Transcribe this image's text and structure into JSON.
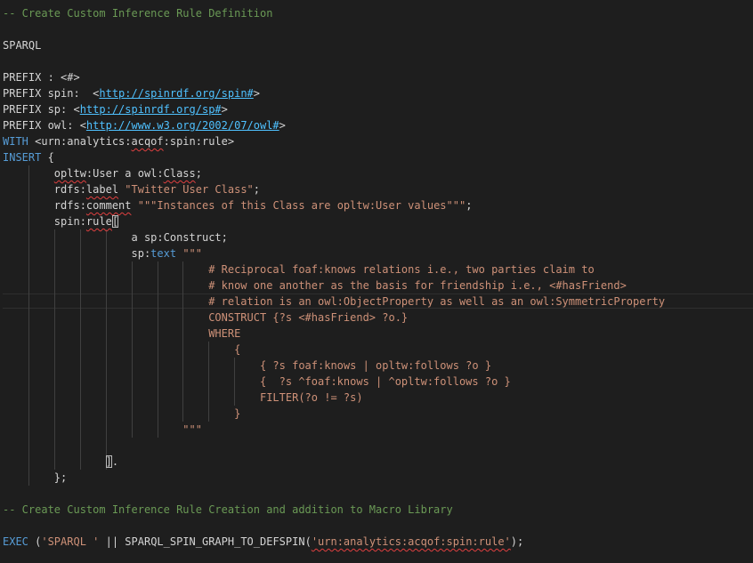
{
  "editor": {
    "lines": [
      [
        {
          "t": "-- Create Custom Inference Rule Definition",
          "c": "comment"
        }
      ],
      [],
      [
        {
          "t": "SPARQL",
          "c": "plain"
        }
      ],
      [],
      [
        {
          "t": "PREFIX : <#>",
          "c": "plain"
        }
      ],
      [
        {
          "t": "PREFIX spin:  <",
          "c": "plain"
        },
        {
          "t": "http://spinrdf.org/spin#",
          "c": "link"
        },
        {
          "t": ">",
          "c": "plain"
        }
      ],
      [
        {
          "t": "PREFIX sp: <",
          "c": "plain"
        },
        {
          "t": "http://spinrdf.org/sp#",
          "c": "link"
        },
        {
          "t": ">",
          "c": "plain"
        }
      ],
      [
        {
          "t": "PREFIX owl: <",
          "c": "plain"
        },
        {
          "t": "http://www.w3.org/2002/07/owl#",
          "c": "link"
        },
        {
          "t": ">",
          "c": "plain"
        }
      ],
      [
        {
          "t": "WITH",
          "c": "kw"
        },
        {
          "t": " <urn:analytics:",
          "c": "plain"
        },
        {
          "t": "acqof",
          "c": "plain",
          "s": true
        },
        {
          "t": ":spin:rule>",
          "c": "plain"
        }
      ],
      [
        {
          "t": "INSERT",
          "c": "kw"
        },
        {
          "t": " {",
          "c": "plain"
        }
      ],
      [
        {
          "t": "        ",
          "c": "plain"
        },
        {
          "t": "opltw",
          "c": "plain",
          "s": true
        },
        {
          "t": ":User a owl:",
          "c": "plain"
        },
        {
          "t": "Class",
          "c": "plain",
          "s": true
        },
        {
          "t": ";",
          "c": "plain"
        }
      ],
      [
        {
          "t": "        rdfs:",
          "c": "plain"
        },
        {
          "t": "label",
          "c": "plain",
          "s": true
        },
        {
          "t": " ",
          "c": "plain"
        },
        {
          "t": "\"Twitter User Class\"",
          "c": "str"
        },
        {
          "t": ";",
          "c": "plain"
        }
      ],
      [
        {
          "t": "        rdfs:",
          "c": "plain"
        },
        {
          "t": "comment",
          "c": "plain",
          "s": true
        },
        {
          "t": " ",
          "c": "plain"
        },
        {
          "t": "\"\"\"Instances of this Class are opltw:User values\"\"\"",
          "c": "str"
        },
        {
          "t": ";",
          "c": "plain"
        }
      ],
      [
        {
          "t": "        spin:",
          "c": "plain"
        },
        {
          "t": "rule",
          "c": "plain",
          "s": true
        },
        {
          "t": "[",
          "c": "plain",
          "b": true
        }
      ],
      [
        {
          "t": "                    a sp:Construct;",
          "c": "plain"
        }
      ],
      [
        {
          "t": "                    sp:",
          "c": "plain"
        },
        {
          "t": "text",
          "c": "kw"
        },
        {
          "t": " ",
          "c": "plain"
        },
        {
          "t": "\"\"\"",
          "c": "str"
        }
      ],
      [
        {
          "t": "                                # Reciprocal foaf:knows relations i.e., two parties claim to",
          "c": "str"
        }
      ],
      [
        {
          "t": "                                # know one another as the basis for friendship i.e., <#hasFriend>",
          "c": "str"
        }
      ],
      [
        {
          "t": "                                # relation is an owl:ObjectProperty as well as an owl:SymmetricProperty",
          "c": "str"
        }
      ],
      [
        {
          "t": "                                CONSTRUCT {?s <#hasFriend> ?o.}",
          "c": "str"
        }
      ],
      [
        {
          "t": "                                WHERE",
          "c": "str"
        }
      ],
      [
        {
          "t": "                                    {",
          "c": "str"
        }
      ],
      [
        {
          "t": "                                        { ?s foaf:knows | opltw:follows ?o }",
          "c": "str"
        }
      ],
      [
        {
          "t": "                                        {  ?s ^foaf:knows | ^opltw:follows ?o }",
          "c": "str"
        }
      ],
      [
        {
          "t": "                                        FILTER(?o != ?s)",
          "c": "str"
        }
      ],
      [
        {
          "t": "                                    }",
          "c": "str"
        }
      ],
      [
        {
          "t": "                            \"\"\"",
          "c": "str"
        }
      ],
      [],
      [
        {
          "t": "                ",
          "c": "plain"
        },
        {
          "t": "]",
          "c": "plain",
          "b": true
        },
        {
          "t": ".",
          "c": "plain"
        }
      ],
      [
        {
          "t": "        };",
          "c": "plain"
        }
      ],
      [],
      [
        {
          "t": "-- Create Custom Inference Rule Creation and addition to Macro Library",
          "c": "comment"
        }
      ],
      [],
      [
        {
          "t": "EXEC",
          "c": "kw"
        },
        {
          "t": " (",
          "c": "plain"
        },
        {
          "t": "'SPARQL '",
          "c": "str"
        },
        {
          "t": " || SPARQL_SPIN_GRAPH_TO_DEFSPIN(",
          "c": "plain"
        },
        {
          "t": "'urn:analytics:acqof:spin:rule'",
          "c": "str",
          "s": true
        },
        {
          "t": ");",
          "c": "plain"
        }
      ]
    ]
  }
}
